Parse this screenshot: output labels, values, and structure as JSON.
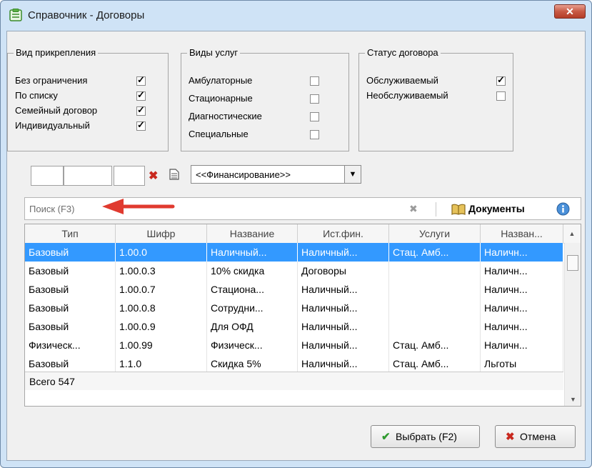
{
  "window": {
    "title": "Справочник - Договоры",
    "close_label": "✕"
  },
  "groups": {
    "attach": {
      "title": "Вид прикрепления",
      "options": [
        {
          "label": "Без ограничения",
          "checked": true
        },
        {
          "label": "По списку",
          "checked": true
        },
        {
          "label": "Семейный договор",
          "checked": true
        },
        {
          "label": "Индивидуальный",
          "checked": true
        }
      ]
    },
    "services": {
      "title": "Виды услуг",
      "options": [
        {
          "label": "Амбулаторные",
          "checked": false
        },
        {
          "label": "Стационарные",
          "checked": false
        },
        {
          "label": "Диагностические",
          "checked": false
        },
        {
          "label": "Специальные",
          "checked": false
        }
      ]
    },
    "status": {
      "title": "Статус договора",
      "options": [
        {
          "label": "Обслуживаемый",
          "checked": true
        },
        {
          "label": "Необслуживаемый",
          "checked": false
        }
      ]
    }
  },
  "filter": {
    "financing_value": "<<Финансирование>>"
  },
  "search": {
    "placeholder": "Поиск (F3)",
    "documents_label": "Документы"
  },
  "table": {
    "columns": [
      "Тип",
      "Шифр",
      "Название",
      "Ист.фин.",
      "Услуги",
      "Назван..."
    ],
    "rows": [
      [
        "Базовый",
        "1.00.0",
        "Наличный...",
        "Наличный...",
        "Стац. Амб...",
        "Наличн..."
      ],
      [
        "Базовый",
        "1.00.0.3",
        "10% скидка",
        "Договоры",
        "",
        "Наличн..."
      ],
      [
        "Базовый",
        "1.00.0.7",
        "Стациона...",
        "Наличный...",
        "",
        "Наличн..."
      ],
      [
        "Базовый",
        "1.00.0.8",
        "Сотрудни...",
        "Наличный...",
        "",
        "Наличн..."
      ],
      [
        "Базовый",
        "1.00.0.9",
        "Для ОФД",
        "Наличный...",
        "",
        "Наличн..."
      ],
      [
        "Физическ...",
        "1.00.99",
        "Физическ...",
        "Наличный...",
        "Стац. Амб...",
        "Наличн..."
      ],
      [
        "Базовый",
        "1.1.0",
        "Скидка 5%",
        "Наличный...",
        "Стац. Амб...",
        "Льготы"
      ]
    ],
    "selected_row": 0,
    "total_label": "Всего 547"
  },
  "buttons": {
    "select_label": "Выбрать (F2)",
    "cancel_label": "Отмена"
  },
  "colors": {
    "selection": "#3399ff",
    "annotation_arrow": "#e03a2f"
  }
}
